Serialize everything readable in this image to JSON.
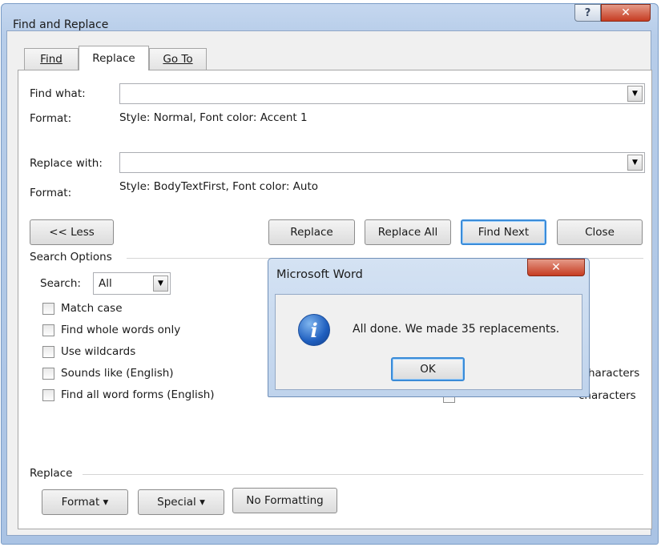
{
  "window": {
    "title": "Find and Replace",
    "help_glyph": "?",
    "close_glyph": "✕"
  },
  "tabs": [
    {
      "label": "Find",
      "active": false
    },
    {
      "label": "Replace",
      "active": true
    },
    {
      "label": "Go To",
      "active": false
    }
  ],
  "find": {
    "label": "Find what:",
    "value": "",
    "format_label": "Format:",
    "format_value": "Style: Normal, Font color: Accent 1"
  },
  "replace": {
    "label": "Replace with:",
    "value": "",
    "format_label": "Format:",
    "format_value": "Style: BodyTextFirst, Font color: Auto"
  },
  "buttons": {
    "less": "<< Less",
    "replace": "Replace",
    "replace_all": "Replace All",
    "find_next": "Find Next",
    "close": "Close"
  },
  "search_options": {
    "header": "Search Options",
    "search_label": "Search:",
    "search_value": "All",
    "left_options": [
      {
        "label": "Match case",
        "checked": false
      },
      {
        "label": "Find whole words only",
        "checked": false
      },
      {
        "label": "Use wildcards",
        "checked": false
      },
      {
        "label": "Sounds like (English)",
        "checked": false
      },
      {
        "label": "Find all word forms (English)",
        "checked": false
      }
    ],
    "right_partial_1": "haracters",
    "right_partial_2": "characters"
  },
  "replace_group": {
    "header": "Replace",
    "format_button": "Format ▾",
    "special_button": "Special ▾",
    "no_formatting_button": "No Formatting"
  },
  "message_box": {
    "title": "Microsoft Word",
    "close_glyph": "✕",
    "icon": "info-icon",
    "icon_glyph": "i",
    "text": "All done. We made 35 replacements.",
    "ok": "OK"
  }
}
